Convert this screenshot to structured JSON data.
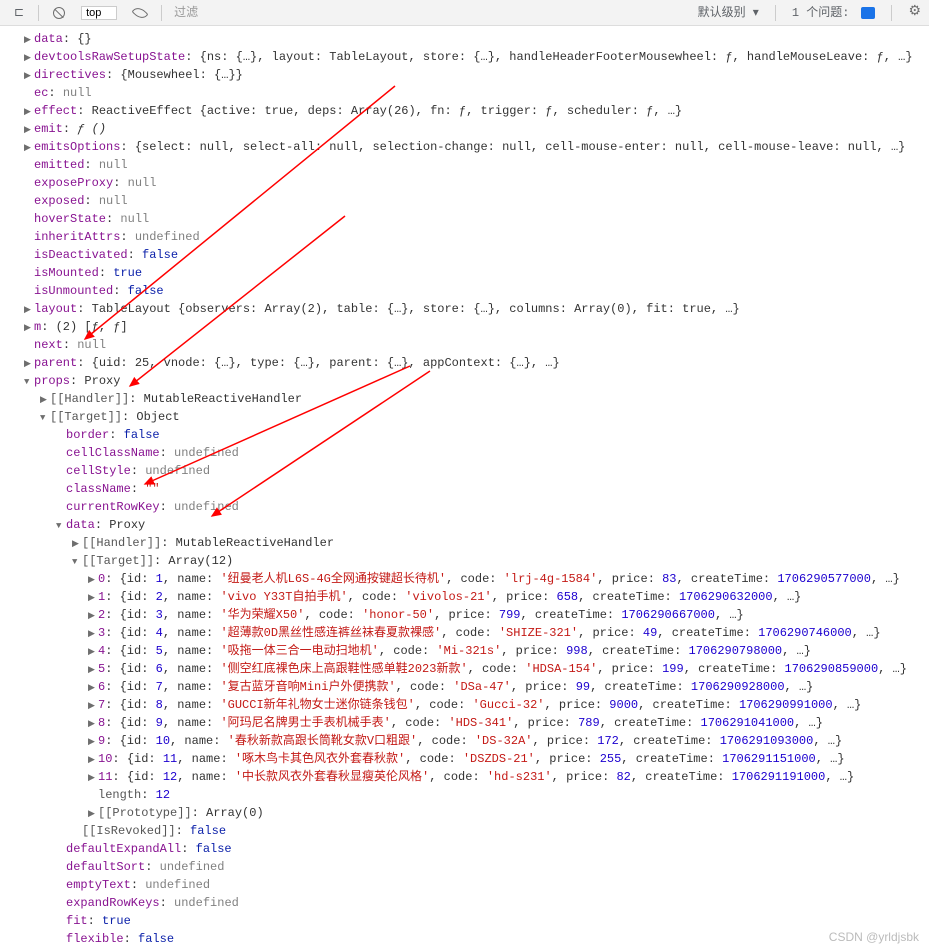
{
  "toolbar": {
    "context": "top",
    "filter_placeholder": "过滤",
    "levels": "默认级别",
    "issues_label": "1 个问题:"
  },
  "watermark": "CSDN @yrldjsbk",
  "lines": {
    "data": "data",
    "devtoolsRawSetupState": "devtoolsRawSetupState",
    "directives": "directives",
    "ec": "ec",
    "effect": "effect",
    "emit": "emit",
    "emitsOptions": "emitsOptions",
    "emitted": "emitted",
    "exposeProxy": "exposeProxy",
    "exposed": "exposed",
    "hoverState": "hoverState",
    "inheritAttrs": "inheritAttrs",
    "isDeactivated": "isDeactivated",
    "isMounted": "isMounted",
    "isUnmounted": "isUnmounted",
    "layout": "layout",
    "m": "m",
    "next": "next",
    "parent": "parent",
    "props": "props",
    "handler": "[[Handler]]",
    "target": "[[Target]]",
    "border": "border",
    "cellClassName": "cellClassName",
    "cellStyle": "cellStyle",
    "className": "className",
    "currentRowKey": "currentRowKey",
    "data2": "data",
    "length": "length",
    "prototype": "[[Prototype]]",
    "isRevoked": "[[IsRevoked]]",
    "defaultExpandAll": "defaultExpandAll",
    "defaultSort": "defaultSort",
    "emptyText": "emptyText",
    "expandRowKeys": "expandRowKeys",
    "fit": "fit",
    "flexible": "flexible"
  },
  "vals": {
    "devtoolsRawSetupState": "{ns: {…}, layout: TableLayout, store: {…}, handleHeaderFooterMousewheel: ƒ, handleMouseLeave: ƒ, …}",
    "directives": "{Mousewheel: {…}}",
    "null": "null",
    "undefined": "undefined",
    "emptyObj": "{}",
    "effect": "ReactiveEffect {active: true, deps: Array(26), fn: ƒ, trigger: ƒ, scheduler: ƒ, …}",
    "emit": "ƒ ()",
    "emitsOptions": "{select: null, select-all: null, selection-change: null, cell-mouse-enter: null, cell-mouse-leave: null, …}",
    "false": "false",
    "true": "true",
    "layout": "TableLayout {observers: Array(2), table: {…}, store: {…}, columns: Array(0), fit: true, …}",
    "m": "(2) [ƒ, ƒ]",
    "parent": "{uid: 25, vnode: {…}, type: {…}, parent: {…}, appContext: {…}, …}",
    "proxy": "Proxy",
    "mutableHandler": "MutableReactiveHandler",
    "object": "Object",
    "emptyStr": "\"\"",
    "array12": "Array(12)",
    "array0": "Array(0)",
    "twelve": "12"
  },
  "items": [
    {
      "idx": "0",
      "id": "1",
      "name": "'纽曼老人机L6S-4G全网通按键超长待机'",
      "code": "'lrj-4g-1584'",
      "price": "83",
      "createTime": "1706290577000"
    },
    {
      "idx": "1",
      "id": "2",
      "name": "'vivo Y33T自拍手机'",
      "code": "'vivolos-21'",
      "price": "658",
      "createTime": "1706290632000"
    },
    {
      "idx": "2",
      "id": "3",
      "name": "'华为荣耀X50'",
      "code": "'honor-50'",
      "price": "799",
      "createTime": "1706290667000"
    },
    {
      "idx": "3",
      "id": "4",
      "name": "'超薄款0D黑丝性感连裤丝袜春夏款裸感'",
      "code": "'SHIZE-321'",
      "price": "49",
      "createTime": "1706290746000"
    },
    {
      "idx": "4",
      "id": "5",
      "name": "'吸拖一体三合一电动扫地机'",
      "code": "'Mi-321s'",
      "price": "998",
      "createTime": "1706290798000"
    },
    {
      "idx": "5",
      "id": "6",
      "name": "'侧空红底裸色床上高跟鞋性感单鞋2023新款'",
      "code": "'HDSA-154'",
      "price": "199",
      "createTime": "1706290859000"
    },
    {
      "idx": "6",
      "id": "7",
      "name": "'复古蓝牙音响Mini户外便携款'",
      "code": "'DSa-47'",
      "price": "99",
      "createTime": "1706290928000"
    },
    {
      "idx": "7",
      "id": "8",
      "name": "'GUCCI新年礼物女士迷你链条钱包'",
      "code": "'Gucci-32'",
      "price": "9000",
      "createTime": "1706290991000"
    },
    {
      "idx": "8",
      "id": "9",
      "name": "'阿玛尼名牌男士手表机械手表'",
      "code": "'HDS-341'",
      "price": "789",
      "createTime": "1706291041000"
    },
    {
      "idx": "9",
      "id": "10",
      "name": "'春秋新款高跟长筒靴女款V口粗跟'",
      "code": "'DS-32A'",
      "price": "172",
      "createTime": "1706291093000"
    },
    {
      "idx": "10",
      "id": "11",
      "name": "'啄木鸟卡其色风衣外套春秋款'",
      "code": "'DSZDS-21'",
      "price": "255",
      "createTime": "1706291151000"
    },
    {
      "idx": "11",
      "id": "12",
      "name": "'中长款风衣外套春秋显瘦英伦风格'",
      "code": "'hd-s231'",
      "price": "82",
      "createTime": "1706291191000"
    }
  ]
}
